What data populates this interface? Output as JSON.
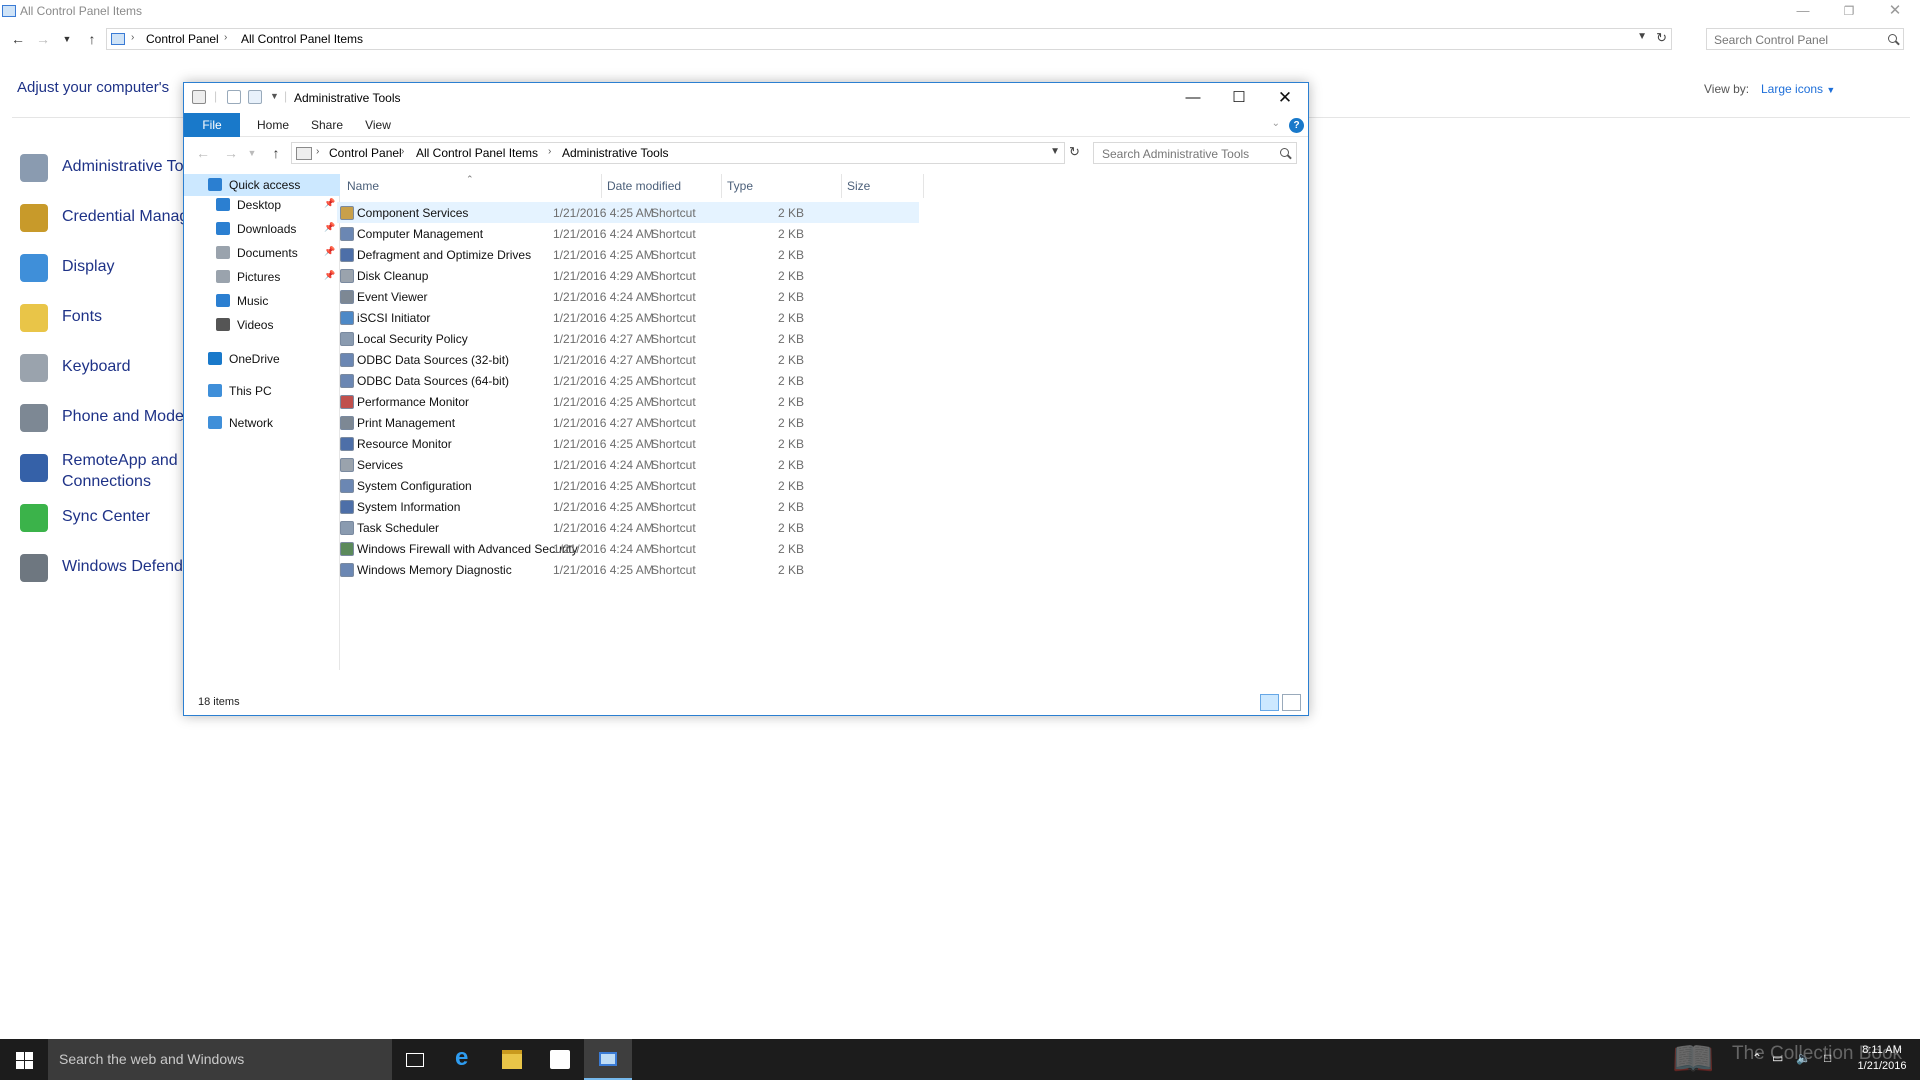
{
  "control_panel": {
    "window_title": "All Control Panel Items",
    "breadcrumbs": [
      "Control Panel",
      "All Control Panel Items"
    ],
    "search_placeholder": "Search Control Panel",
    "heading": "Adjust your computer's",
    "view_by_label": "View by:",
    "view_by_value": "Large icons",
    "items": [
      {
        "label": "Administrative To",
        "icon": "administrative-tools-icon",
        "color": "#8a9bb0"
      },
      {
        "label": "Credential Manag",
        "icon": "credential-manager-icon",
        "color": "#c89a2a"
      },
      {
        "label": "Display",
        "icon": "display-icon",
        "color": "#3f8fd9"
      },
      {
        "label": "Fonts",
        "icon": "fonts-icon",
        "color": "#e9c548"
      },
      {
        "label": "Keyboard",
        "icon": "keyboard-icon",
        "color": "#9aa3ad"
      },
      {
        "label": "Phone and Moder",
        "icon": "phone-modem-icon",
        "color": "#7d8894"
      },
      {
        "label": "RemoteApp and D",
        "label2": "Connections",
        "icon": "remoteapp-icon",
        "color": "#3561a8"
      },
      {
        "label": "Sync Center",
        "icon": "sync-center-icon",
        "color": "#3bb34a"
      },
      {
        "label": "Windows Defende",
        "icon": "windows-defender-icon",
        "color": "#6e7780"
      }
    ]
  },
  "explorer": {
    "title": "Administrative Tools",
    "ribbon_tabs": [
      "File",
      "Home",
      "Share",
      "View"
    ],
    "breadcrumbs": [
      "Control Panel",
      "All Control Panel Items",
      "Administrative Tools"
    ],
    "search_placeholder": "Search Administrative Tools",
    "nav": [
      {
        "label": "Quick access",
        "icon": "quick-access-star-icon",
        "pinned": false,
        "color": "#2b7fd1"
      },
      {
        "label": "Desktop",
        "icon": "desktop-folder-icon",
        "pinned": true,
        "color": "#2b7fd1"
      },
      {
        "label": "Downloads",
        "icon": "downloads-folder-icon",
        "pinned": true,
        "color": "#2b7fd1"
      },
      {
        "label": "Documents",
        "icon": "documents-folder-icon",
        "pinned": true,
        "color": "#9aa3ad"
      },
      {
        "label": "Pictures",
        "icon": "pictures-folder-icon",
        "pinned": true,
        "color": "#9aa3ad"
      },
      {
        "label": "Music",
        "icon": "music-folder-icon",
        "pinned": false,
        "color": "#2b7fd1"
      },
      {
        "label": "Videos",
        "icon": "videos-folder-icon",
        "pinned": false,
        "color": "#555555"
      },
      {
        "label": "OneDrive",
        "icon": "onedrive-cloud-icon",
        "pinned": false,
        "color": "#1979ca"
      },
      {
        "label": "This PC",
        "icon": "this-pc-icon",
        "pinned": false,
        "color": "#3f8fd9"
      },
      {
        "label": "Network",
        "icon": "network-icon",
        "pinned": false,
        "color": "#3f8fd9"
      }
    ],
    "columns": [
      "Name",
      "Date modified",
      "Type",
      "Size"
    ],
    "files": [
      {
        "name": "Component Services",
        "date": "1/21/2016 4:25 AM",
        "type": "Shortcut",
        "size": "2 KB"
      },
      {
        "name": "Computer Management",
        "date": "1/21/2016 4:24 AM",
        "type": "Shortcut",
        "size": "2 KB"
      },
      {
        "name": "Defragment and Optimize Drives",
        "date": "1/21/2016 4:25 AM",
        "type": "Shortcut",
        "size": "2 KB"
      },
      {
        "name": "Disk Cleanup",
        "date": "1/21/2016 4:29 AM",
        "type": "Shortcut",
        "size": "2 KB"
      },
      {
        "name": "Event Viewer",
        "date": "1/21/2016 4:24 AM",
        "type": "Shortcut",
        "size": "2 KB"
      },
      {
        "name": "iSCSI Initiator",
        "date": "1/21/2016 4:25 AM",
        "type": "Shortcut",
        "size": "2 KB"
      },
      {
        "name": "Local Security Policy",
        "date": "1/21/2016 4:27 AM",
        "type": "Shortcut",
        "size": "2 KB"
      },
      {
        "name": "ODBC Data Sources (32-bit)",
        "date": "1/21/2016 4:27 AM",
        "type": "Shortcut",
        "size": "2 KB"
      },
      {
        "name": "ODBC Data Sources (64-bit)",
        "date": "1/21/2016 4:25 AM",
        "type": "Shortcut",
        "size": "2 KB"
      },
      {
        "name": "Performance Monitor",
        "date": "1/21/2016 4:25 AM",
        "type": "Shortcut",
        "size": "2 KB"
      },
      {
        "name": "Print Management",
        "date": "1/21/2016 4:27 AM",
        "type": "Shortcut",
        "size": "2 KB"
      },
      {
        "name": "Resource Monitor",
        "date": "1/21/2016 4:25 AM",
        "type": "Shortcut",
        "size": "2 KB"
      },
      {
        "name": "Services",
        "date": "1/21/2016 4:24 AM",
        "type": "Shortcut",
        "size": "2 KB"
      },
      {
        "name": "System Configuration",
        "date": "1/21/2016 4:25 AM",
        "type": "Shortcut",
        "size": "2 KB"
      },
      {
        "name": "System Information",
        "date": "1/21/2016 4:25 AM",
        "type": "Shortcut",
        "size": "2 KB"
      },
      {
        "name": "Task Scheduler",
        "date": "1/21/2016 4:24 AM",
        "type": "Shortcut",
        "size": "2 KB"
      },
      {
        "name": "Windows Firewall with Advanced Security",
        "date": "1/21/2016 4:24 AM",
        "type": "Shortcut",
        "size": "2 KB"
      },
      {
        "name": "Windows Memory Diagnostic",
        "date": "1/21/2016 4:25 AM",
        "type": "Shortcut",
        "size": "2 KB"
      }
    ],
    "status": "18 items"
  },
  "taskbar": {
    "search_placeholder": "Search the web and Windows",
    "watermark": "The Collection Book",
    "time": "8:11 AM",
    "date": "1/21/2016",
    "accent_color": "#76b9ed"
  }
}
